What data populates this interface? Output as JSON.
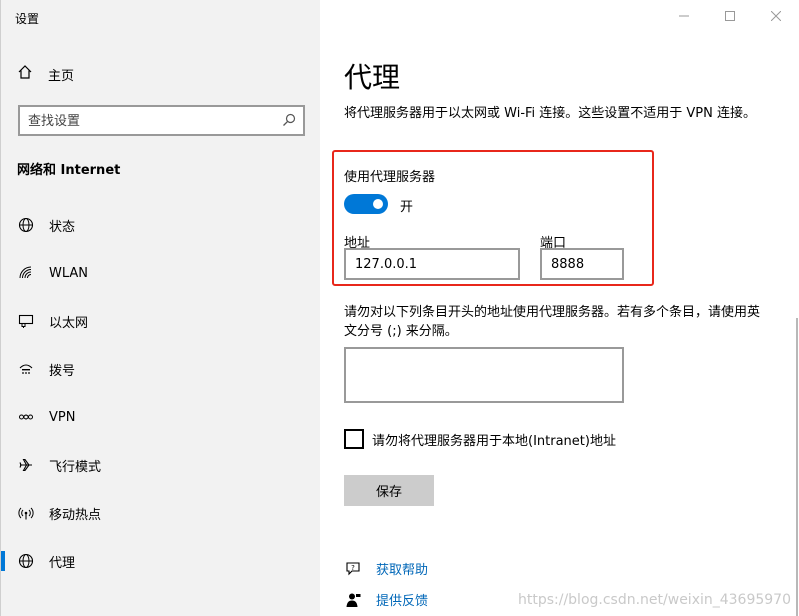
{
  "window": {
    "title": "设置"
  },
  "sidebar": {
    "home_label": "主页",
    "search_placeholder": "查找设置",
    "section_title": "网络和 Internet",
    "items": [
      {
        "label": "状态",
        "icon": "globe-status-icon"
      },
      {
        "label": "WLAN",
        "icon": "wifi-icon"
      },
      {
        "label": "以太网",
        "icon": "ethernet-icon"
      },
      {
        "label": "拨号",
        "icon": "dialup-icon"
      },
      {
        "label": "VPN",
        "icon": "vpn-icon"
      },
      {
        "label": "飞行模式",
        "icon": "airplane-icon"
      },
      {
        "label": "移动热点",
        "icon": "hotspot-icon"
      },
      {
        "label": "代理",
        "icon": "globe-icon",
        "active": true
      }
    ]
  },
  "main": {
    "title": "代理",
    "description": "将代理服务器用于以太网或 Wi-Fi 连接。这些设置不适用于 VPN 连接。",
    "manual_proxy": {
      "heading": "使用代理服务器",
      "toggle_state": "开",
      "toggle_on": true,
      "address_label": "地址",
      "address_value": "127.0.0.1",
      "port_label": "端口",
      "port_value": "8888"
    },
    "exceptions_description": "请勿对以下列条目开头的地址使用代理服务器。若有多个条目，请使用英文分号 (;) 来分隔。",
    "exceptions_value": "",
    "bypass_local_label": "请勿将代理服务器用于本地(Intranet)地址",
    "bypass_local_checked": false,
    "save_label": "保存",
    "help_link": "获取帮助",
    "feedback_link": "提供反馈"
  },
  "watermark": "https://blog.csdn.net/weixin_43695970",
  "colors": {
    "accent": "#0078d7",
    "link": "#0067b8",
    "highlight_border": "#e8271b",
    "sidebar_bg": "#f2f2f2"
  }
}
